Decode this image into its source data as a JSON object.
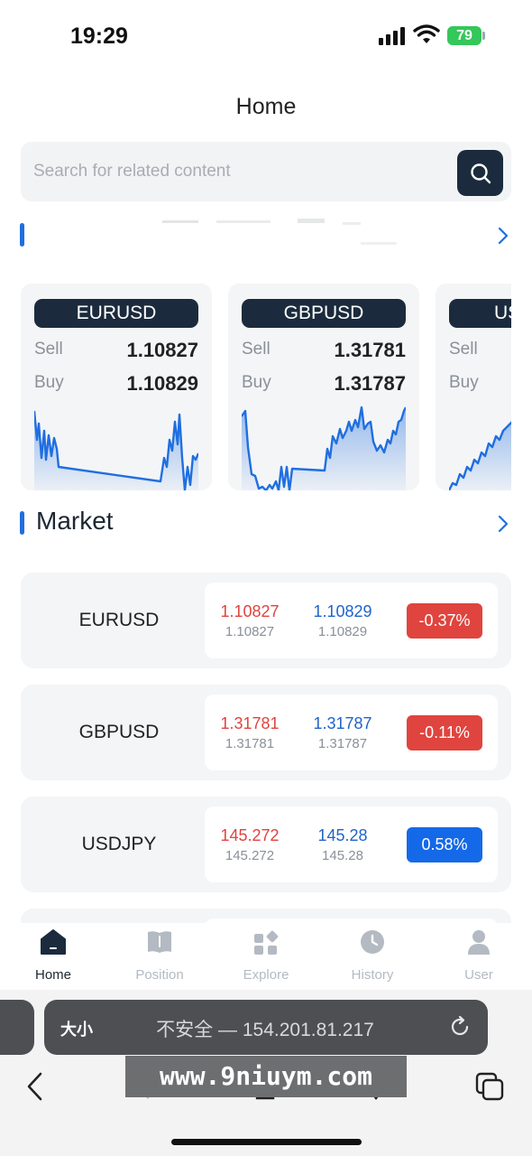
{
  "status": {
    "time": "19:29",
    "battery": "79"
  },
  "page": {
    "title": "Home"
  },
  "search": {
    "placeholder": "Search for related content"
  },
  "pairs": [
    {
      "symbol": "EURUSD",
      "sell_label": "Sell",
      "sell": "1.10827",
      "buy_label": "Buy",
      "buy": "1.10829"
    },
    {
      "symbol": "GBPUSD",
      "sell_label": "Sell",
      "sell": "1.31781",
      "buy_label": "Buy",
      "buy": "1.31787"
    },
    {
      "symbol": "US",
      "sell_label": "Sell",
      "sell": "",
      "buy_label": "Buy",
      "buy": ""
    }
  ],
  "market": {
    "title": "Market",
    "rows": [
      {
        "symbol": "EURUSD",
        "sell": "1.10827",
        "sell_sub": "1.10827",
        "buy": "1.10829",
        "buy_sub": "1.10829",
        "change": "-0.37%",
        "direction": "down"
      },
      {
        "symbol": "GBPUSD",
        "sell": "1.31781",
        "sell_sub": "1.31781",
        "buy": "1.31787",
        "buy_sub": "1.31787",
        "change": "-0.11%",
        "direction": "down"
      },
      {
        "symbol": "USDJPY",
        "sell": "145.272",
        "sell_sub": "145.272",
        "buy": "145.28",
        "buy_sub": "145.28",
        "change": "0.58%",
        "direction": "up"
      }
    ]
  },
  "tabs": [
    {
      "label": "Home",
      "icon": "home-icon",
      "active": true
    },
    {
      "label": "Position",
      "icon": "book-icon",
      "active": false
    },
    {
      "label": "Explore",
      "icon": "explore-icon",
      "active": false
    },
    {
      "label": "History",
      "icon": "clock-icon",
      "active": false
    },
    {
      "label": "User",
      "icon": "user-icon",
      "active": false
    }
  ],
  "browser": {
    "text_size": "大小",
    "address": "不安全 — 154.201.81.217"
  },
  "watermark": "www.9niuym.com",
  "colors": {
    "accent": "#1f6fe0",
    "navy": "#1b2b3d",
    "down": "#e0443e",
    "up": "#1469e8",
    "sell": "#e0443e",
    "buy": "#1f64c8"
  }
}
